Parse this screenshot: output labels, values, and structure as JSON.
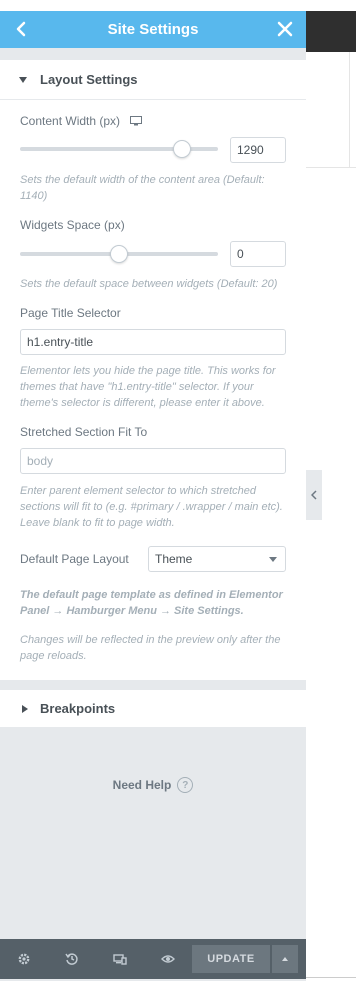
{
  "header": {
    "title": "Site Settings"
  },
  "layout_section": {
    "title": "Layout Settings",
    "content_width": {
      "label": "Content Width (px)",
      "value": "1290",
      "slider_fraction": 0.82,
      "description": "Sets the default width of the content area (Default: 1140)"
    },
    "widgets_space": {
      "label": "Widgets Space (px)",
      "value": "0",
      "slider_fraction": 0.5,
      "description": "Sets the default space between widgets (Default: 20)"
    },
    "page_title_selector": {
      "label": "Page Title Selector",
      "value": "h1.entry-title",
      "description": "Elementor lets you hide the page title. This works for themes that have \"h1.entry-title\" selector. If your theme's selector is different, please enter it above."
    },
    "stretched_section": {
      "label": "Stretched Section Fit To",
      "placeholder": "body",
      "description": "Enter parent element selector to which stretched sections will fit to (e.g. #primary / .wrapper / main etc). Leave blank to fit to page width."
    },
    "default_page_layout": {
      "label": "Default Page Layout",
      "selected": "Theme",
      "description_bold": "The default page template as defined in Elementor Panel → Hamburger Menu → Site Settings.",
      "description": "Changes will be reflected in the preview only after the page reloads."
    }
  },
  "breakpoints_section": {
    "title": "Breakpoints"
  },
  "help": {
    "label": "Need Help",
    "icon_glyph": "?"
  },
  "footer": {
    "update_label": "UPDATE",
    "icons": [
      "gear-icon",
      "history-icon",
      "responsive-icon",
      "eye-icon"
    ]
  },
  "colors": {
    "header": "#58b8ed",
    "footer": "#556068",
    "panel_bg": "#e6e9ec"
  }
}
